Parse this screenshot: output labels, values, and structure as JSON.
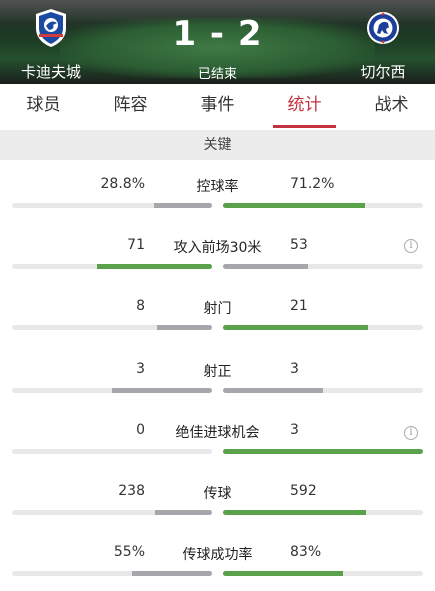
{
  "match": {
    "home_team": "卡迪夫城",
    "away_team": "切尔西",
    "score": "1 - 2",
    "status": "已结束",
    "home_crest": "cardiff-bluebird-crest",
    "away_crest": "chelsea-lion-crest"
  },
  "tabs": [
    {
      "label": "球员",
      "active": false
    },
    {
      "label": "阵容",
      "active": false
    },
    {
      "label": "事件",
      "active": false
    },
    {
      "label": "统计",
      "active": true
    },
    {
      "label": "战术",
      "active": false
    }
  ],
  "section_title": "关键",
  "colors": {
    "accent": "#c4323f",
    "leading_bar": "#5aa14c",
    "trailing_bar": "#a7a7ab",
    "track": "#e8e8e8"
  },
  "stats": [
    {
      "label": "控球率",
      "home": "28.8%",
      "away": "71.2%",
      "home_share": 0.288,
      "away_share": 0.712,
      "info_icon": false
    },
    {
      "label": "攻入前场30米",
      "home": "71",
      "away": "53",
      "home_share": 0.573,
      "away_share": 0.427,
      "info_icon": true
    },
    {
      "label": "射门",
      "home": "8",
      "away": "21",
      "home_share": 0.276,
      "away_share": 0.724,
      "info_icon": false
    },
    {
      "label": "射正",
      "home": "3",
      "away": "3",
      "home_share": 0.5,
      "away_share": 0.5,
      "info_icon": false
    },
    {
      "label": "绝佳进球机会",
      "home": "0",
      "away": "3",
      "home_share": 0.0,
      "away_share": 1.0,
      "info_icon": true
    },
    {
      "label": "传球",
      "home": "238",
      "away": "592",
      "home_share": 0.287,
      "away_share": 0.713,
      "info_icon": false
    },
    {
      "label": "传球成功率",
      "home": "55%",
      "away": "83%",
      "home_share": 0.399,
      "away_share": 0.601,
      "info_icon": false
    }
  ]
}
